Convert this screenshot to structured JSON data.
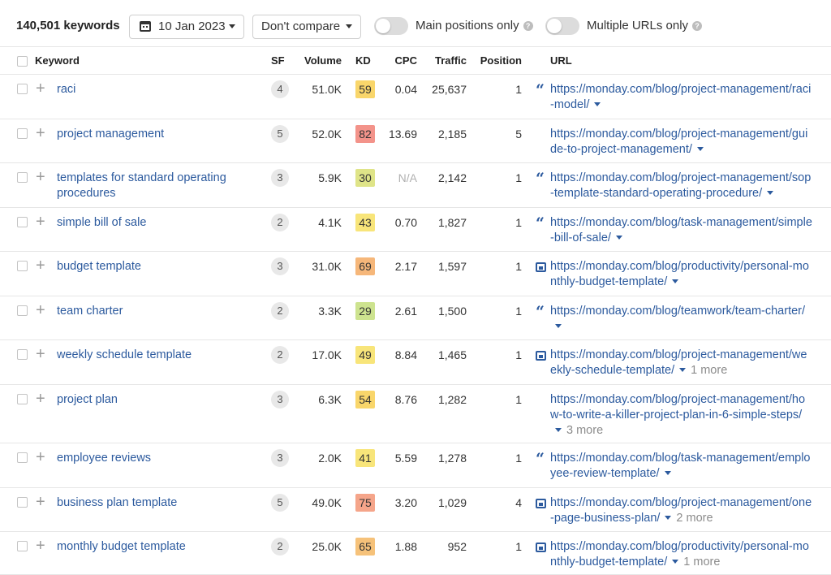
{
  "toolbar": {
    "keyword_count": "140,501 keywords",
    "date_label": "10 Jan 2023",
    "compare_label": "Don't compare",
    "main_positions_label": "Main positions only",
    "multiple_urls_label": "Multiple URLs only",
    "help_glyph": "?"
  },
  "columns": {
    "keyword": "Keyword",
    "sf": "SF",
    "volume": "Volume",
    "kd": "KD",
    "cpc": "CPC",
    "traffic": "Traffic",
    "position": "Position",
    "url": "URL"
  },
  "rows": [
    {
      "keyword": "raci",
      "sf": "4",
      "volume": "51.0K",
      "kd": "59",
      "kd_color": "#f9d66b",
      "cpc": "0.04",
      "traffic": "25,637",
      "position": "1",
      "url_icon": "quote-icon",
      "url": "https://monday.com/blog/project-management/raci-model/",
      "more": ""
    },
    {
      "keyword": "project management",
      "sf": "5",
      "volume": "52.0K",
      "kd": "82",
      "kd_color": "#f3938a",
      "cpc": "13.69",
      "traffic": "2,185",
      "position": "5",
      "url_icon": "",
      "url": "https://monday.com/blog/project-management/guide-to-project-management/",
      "more": ""
    },
    {
      "keyword": "templates for standard operating procedures",
      "sf": "3",
      "volume": "5.9K",
      "kd": "30",
      "kd_color": "#dfe488",
      "cpc": "N/A",
      "traffic": "2,142",
      "position": "1",
      "url_icon": "quote-icon",
      "url": "https://monday.com/blog/project-management/sop-template-standard-operating-procedure/",
      "more": ""
    },
    {
      "keyword": "simple bill of sale",
      "sf": "2",
      "volume": "4.1K",
      "kd": "43",
      "kd_color": "#f8e57a",
      "cpc": "0.70",
      "traffic": "1,827",
      "position": "1",
      "url_icon": "quote-icon",
      "url": "https://monday.com/blog/task-management/simple-bill-of-sale/",
      "more": ""
    },
    {
      "keyword": "budget template",
      "sf": "3",
      "volume": "31.0K",
      "kd": "69",
      "kd_color": "#f6b77a",
      "cpc": "2.17",
      "traffic": "1,597",
      "position": "1",
      "url_icon": "image-icon",
      "url": "https://monday.com/blog/productivity/personal-monthly-budget-template/",
      "more": ""
    },
    {
      "keyword": "team charter",
      "sf": "2",
      "volume": "3.3K",
      "kd": "29",
      "kd_color": "#cde38f",
      "cpc": "2.61",
      "traffic": "1,500",
      "position": "1",
      "url_icon": "quote-icon",
      "url": "https://monday.com/blog/teamwork/team-charter/",
      "more": ""
    },
    {
      "keyword": "weekly schedule template",
      "sf": "2",
      "volume": "17.0K",
      "kd": "49",
      "kd_color": "#f8e57a",
      "cpc": "8.84",
      "traffic": "1,465",
      "position": "1",
      "url_icon": "image-icon",
      "url": "https://monday.com/blog/project-management/weekly-schedule-template/",
      "more": "1 more"
    },
    {
      "keyword": "project plan",
      "sf": "3",
      "volume": "6.3K",
      "kd": "54",
      "kd_color": "#f9d66b",
      "cpc": "8.76",
      "traffic": "1,282",
      "position": "1",
      "url_icon": "",
      "url": "https://monday.com/blog/project-management/how-to-write-a-killer-project-plan-in-6-simple-steps/",
      "more": "3 more"
    },
    {
      "keyword": "employee reviews",
      "sf": "3",
      "volume": "2.0K",
      "kd": "41",
      "kd_color": "#f8e57a",
      "cpc": "5.59",
      "traffic": "1,278",
      "position": "1",
      "url_icon": "quote-icon",
      "url": "https://monday.com/blog/task-management/employee-review-template/",
      "more": ""
    },
    {
      "keyword": "business plan template",
      "sf": "5",
      "volume": "49.0K",
      "kd": "75",
      "kd_color": "#f5a58a",
      "cpc": "3.20",
      "traffic": "1,029",
      "position": "4",
      "url_icon": "image-icon",
      "url": "https://monday.com/blog/project-management/one-page-business-plan/",
      "more": "2 more"
    },
    {
      "keyword": "monthly budget template",
      "sf": "2",
      "volume": "25.0K",
      "kd": "65",
      "kd_color": "#f6c27a",
      "cpc": "1.88",
      "traffic": "952",
      "position": "1",
      "url_icon": "image-icon",
      "url": "https://monday.com/blog/productivity/personal-monthly-budget-template/",
      "more": "1 more"
    }
  ]
}
